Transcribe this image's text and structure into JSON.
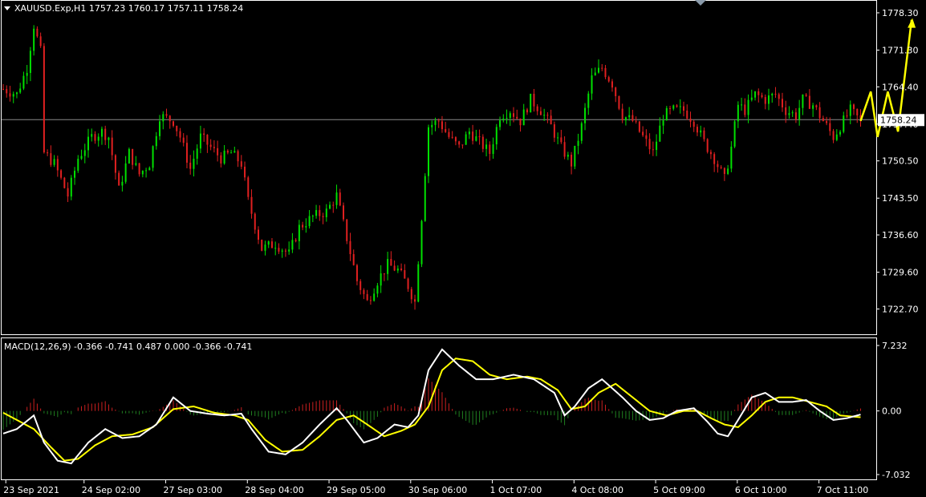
{
  "header": {
    "symbol_line": "XAUUSD.Exp,H1  1757.23 1760.17 1757.11 1758.24"
  },
  "indicator": {
    "label": "MACD(12,26,9) -0.366 -0.741 0.487 0.000 -0.366 -0.741"
  },
  "colors": {
    "background": "#000000",
    "bull": "#00e000",
    "bear": "#e02020",
    "macd_line": "#ffffff",
    "signal_line": "#ffff00",
    "hist_pos": "#cc2020",
    "hist_neg": "#208020",
    "forecast": "#ffff00"
  },
  "chart_data": [
    {
      "type": "candlestick",
      "symbol": "XAUUSD.Exp",
      "timeframe": "H1",
      "last_price": 1758.24,
      "last_price_label": "1758.24",
      "ohlc": {
        "open": 1757.23,
        "high": 1760.17,
        "low": 1757.11,
        "close": 1758.24
      },
      "ylim": [
        1719.0,
        1779.5
      ],
      "y_ticks": [
        "1778.30",
        "1771.30",
        "1764.40",
        "1757.40",
        "1750.50",
        "1743.50",
        "1736.60",
        "1729.60",
        "1722.70"
      ],
      "y_tick_values": [
        1778.3,
        1771.3,
        1764.4,
        1757.4,
        1750.5,
        1743.5,
        1736.6,
        1729.6,
        1722.7
      ],
      "x_ticks": [
        "23 Sep 2021",
        "24 Sep 02:00",
        "27 Sep 03:00",
        "28 Sep 04:00",
        "29 Sep 05:00",
        "30 Sep 06:00",
        "1 Oct 07:00",
        "4 Oct 08:00",
        "5 Oct 09:00",
        "6 Oct 10:00",
        "7 Oct 11:00"
      ],
      "x_tick_bars": [
        1,
        24,
        48,
        72,
        96,
        120,
        144,
        168,
        192,
        216,
        240
      ],
      "close_path": [
        [
          0,
          1764
        ],
        [
          4,
          1763
        ],
        [
          7,
          1768
        ],
        [
          9,
          1776
        ],
        [
          11,
          1771
        ],
        [
          12,
          1752
        ],
        [
          15,
          1750
        ],
        [
          19,
          1744
        ],
        [
          22,
          1751
        ],
        [
          26,
          1755
        ],
        [
          29,
          1756
        ],
        [
          31,
          1755
        ],
        [
          34,
          1745
        ],
        [
          37,
          1752
        ],
        [
          40,
          1748
        ],
        [
          43,
          1750
        ],
        [
          46,
          1759
        ],
        [
          50,
          1758
        ],
        [
          52,
          1755
        ],
        [
          55,
          1749
        ],
        [
          58,
          1755
        ],
        [
          61,
          1753
        ],
        [
          64,
          1751
        ],
        [
          67,
          1752
        ],
        [
          70,
          1750
        ],
        [
          72,
          1743
        ],
        [
          76,
          1734
        ],
        [
          80,
          1735
        ],
        [
          84,
          1733
        ],
        [
          87,
          1738
        ],
        [
          91,
          1740
        ],
        [
          95,
          1741
        ],
        [
          98,
          1744
        ],
        [
          101,
          1736
        ],
        [
          104,
          1728
        ],
        [
          107,
          1724
        ],
        [
          110,
          1728
        ],
        [
          113,
          1731
        ],
        [
          116,
          1730
        ],
        [
          119,
          1727
        ],
        [
          121,
          1724
        ],
        [
          123,
          1740
        ],
        [
          125,
          1757
        ],
        [
          128,
          1758
        ],
        [
          131,
          1755
        ],
        [
          134,
          1753
        ],
        [
          137,
          1756
        ],
        [
          140,
          1754
        ],
        [
          143,
          1752
        ],
        [
          146,
          1759
        ],
        [
          149,
          1760
        ],
        [
          152,
          1758
        ],
        [
          155,
          1762
        ],
        [
          158,
          1760
        ],
        [
          161,
          1757
        ],
        [
          164,
          1753
        ],
        [
          167,
          1750
        ],
        [
          170,
          1757
        ],
        [
          173,
          1766
        ],
        [
          176,
          1768
        ],
        [
          179,
          1765
        ],
        [
          182,
          1759
        ],
        [
          185,
          1758
        ],
        [
          188,
          1755
        ],
        [
          191,
          1752
        ],
        [
          194,
          1759
        ],
        [
          197,
          1760
        ],
        [
          200,
          1760
        ],
        [
          203,
          1758
        ],
        [
          206,
          1754
        ],
        [
          209,
          1751
        ],
        [
          212,
          1747
        ],
        [
          214,
          1753
        ],
        [
          216,
          1761
        ],
        [
          218,
          1760
        ],
        [
          221,
          1763
        ],
        [
          224,
          1762
        ],
        [
          227,
          1763
        ],
        [
          230,
          1760
        ],
        [
          233,
          1759
        ],
        [
          235,
          1762
        ],
        [
          238,
          1761
        ],
        [
          241,
          1758
        ],
        [
          244,
          1755
        ],
        [
          246,
          1757
        ],
        [
          249,
          1760
        ],
        [
          252,
          1758
        ]
      ],
      "forecast_path": [
        [
          252,
          1758
        ],
        [
          255,
          1763.5
        ],
        [
          257,
          1755
        ],
        [
          260,
          1763.5
        ],
        [
          263,
          1756
        ],
        [
          267,
          1777
        ]
      ]
    },
    {
      "type": "line",
      "name": "MACD(12,26,9)",
      "values": {
        "main": -0.366,
        "signal": -0.741,
        "hist": 0.487
      },
      "ylim": [
        -7.032,
        7.232
      ],
      "y_ticks": [
        "7.232",
        "0.00",
        "-7.032"
      ],
      "y_tick_values": [
        7.232,
        0.0,
        -7.032
      ],
      "macd_path": [
        [
          0,
          -2.5
        ],
        [
          4,
          -2.0
        ],
        [
          9,
          -0.5
        ],
        [
          12,
          -3.5
        ],
        [
          16,
          -5.5
        ],
        [
          20,
          -5.8
        ],
        [
          25,
          -3.5
        ],
        [
          30,
          -2.0
        ],
        [
          35,
          -3.0
        ],
        [
          40,
          -2.8
        ],
        [
          45,
          -1.5
        ],
        [
          50,
          1.5
        ],
        [
          55,
          0.0
        ],
        [
          60,
          -0.3
        ],
        [
          65,
          -0.5
        ],
        [
          70,
          -0.3
        ],
        [
          73,
          -2.0
        ],
        [
          78,
          -4.5
        ],
        [
          83,
          -4.8
        ],
        [
          88,
          -3.5
        ],
        [
          93,
          -1.5
        ],
        [
          98,
          0.3
        ],
        [
          101,
          -1.0
        ],
        [
          106,
          -3.5
        ],
        [
          110,
          -3.0
        ],
        [
          115,
          -1.5
        ],
        [
          119,
          -1.8
        ],
        [
          122,
          -0.5
        ],
        [
          125,
          4.5
        ],
        [
          129,
          6.8
        ],
        [
          134,
          5.0
        ],
        [
          139,
          3.5
        ],
        [
          144,
          3.5
        ],
        [
          150,
          4.0
        ],
        [
          156,
          3.5
        ],
        [
          162,
          2.0
        ],
        [
          165,
          -0.5
        ],
        [
          168,
          0.5
        ],
        [
          172,
          2.5
        ],
        [
          176,
          3.5
        ],
        [
          182,
          1.5
        ],
        [
          186,
          0.0
        ],
        [
          190,
          -1.0
        ],
        [
          194,
          -0.8
        ],
        [
          198,
          0.0
        ],
        [
          203,
          0.3
        ],
        [
          207,
          -1.2
        ],
        [
          210,
          -2.5
        ],
        [
          213,
          -2.8
        ],
        [
          216,
          -1.0
        ],
        [
          220,
          1.5
        ],
        [
          224,
          2.0
        ],
        [
          228,
          1.0
        ],
        [
          232,
          1.0
        ],
        [
          236,
          1.2
        ],
        [
          240,
          0.0
        ],
        [
          244,
          -1.0
        ],
        [
          248,
          -0.8
        ],
        [
          252,
          -0.4
        ]
      ],
      "signal_path": [
        [
          0,
          -0.2
        ],
        [
          4,
          -1.0
        ],
        [
          9,
          -2.0
        ],
        [
          14,
          -4.0
        ],
        [
          18,
          -5.5
        ],
        [
          22,
          -5.3
        ],
        [
          27,
          -3.8
        ],
        [
          32,
          -2.8
        ],
        [
          38,
          -2.6
        ],
        [
          44,
          -1.8
        ],
        [
          50,
          0.2
        ],
        [
          56,
          0.5
        ],
        [
          62,
          -0.2
        ],
        [
          68,
          -0.5
        ],
        [
          72,
          -1.0
        ],
        [
          77,
          -3.2
        ],
        [
          82,
          -4.5
        ],
        [
          88,
          -4.3
        ],
        [
          93,
          -2.8
        ],
        [
          98,
          -1.0
        ],
        [
          103,
          -0.5
        ],
        [
          107,
          -1.5
        ],
        [
          112,
          -2.8
        ],
        [
          117,
          -2.2
        ],
        [
          121,
          -1.5
        ],
        [
          125,
          0.5
        ],
        [
          129,
          4.5
        ],
        [
          133,
          5.8
        ],
        [
          138,
          5.5
        ],
        [
          143,
          4.0
        ],
        [
          148,
          3.5
        ],
        [
          154,
          3.8
        ],
        [
          158,
          3.5
        ],
        [
          163,
          2.3
        ],
        [
          167,
          0.2
        ],
        [
          171,
          0.5
        ],
        [
          175,
          2.0
        ],
        [
          180,
          3.0
        ],
        [
          185,
          1.5
        ],
        [
          190,
          0.0
        ],
        [
          195,
          -0.5
        ],
        [
          200,
          0.0
        ],
        [
          204,
          0.0
        ],
        [
          208,
          -0.8
        ],
        [
          212,
          -1.5
        ],
        [
          216,
          -1.8
        ],
        [
          220,
          -0.5
        ],
        [
          224,
          1.0
        ],
        [
          228,
          1.5
        ],
        [
          232,
          1.5
        ],
        [
          237,
          1.0
        ],
        [
          242,
          0.5
        ],
        [
          246,
          -0.5
        ],
        [
          252,
          -0.7
        ]
      ]
    }
  ]
}
